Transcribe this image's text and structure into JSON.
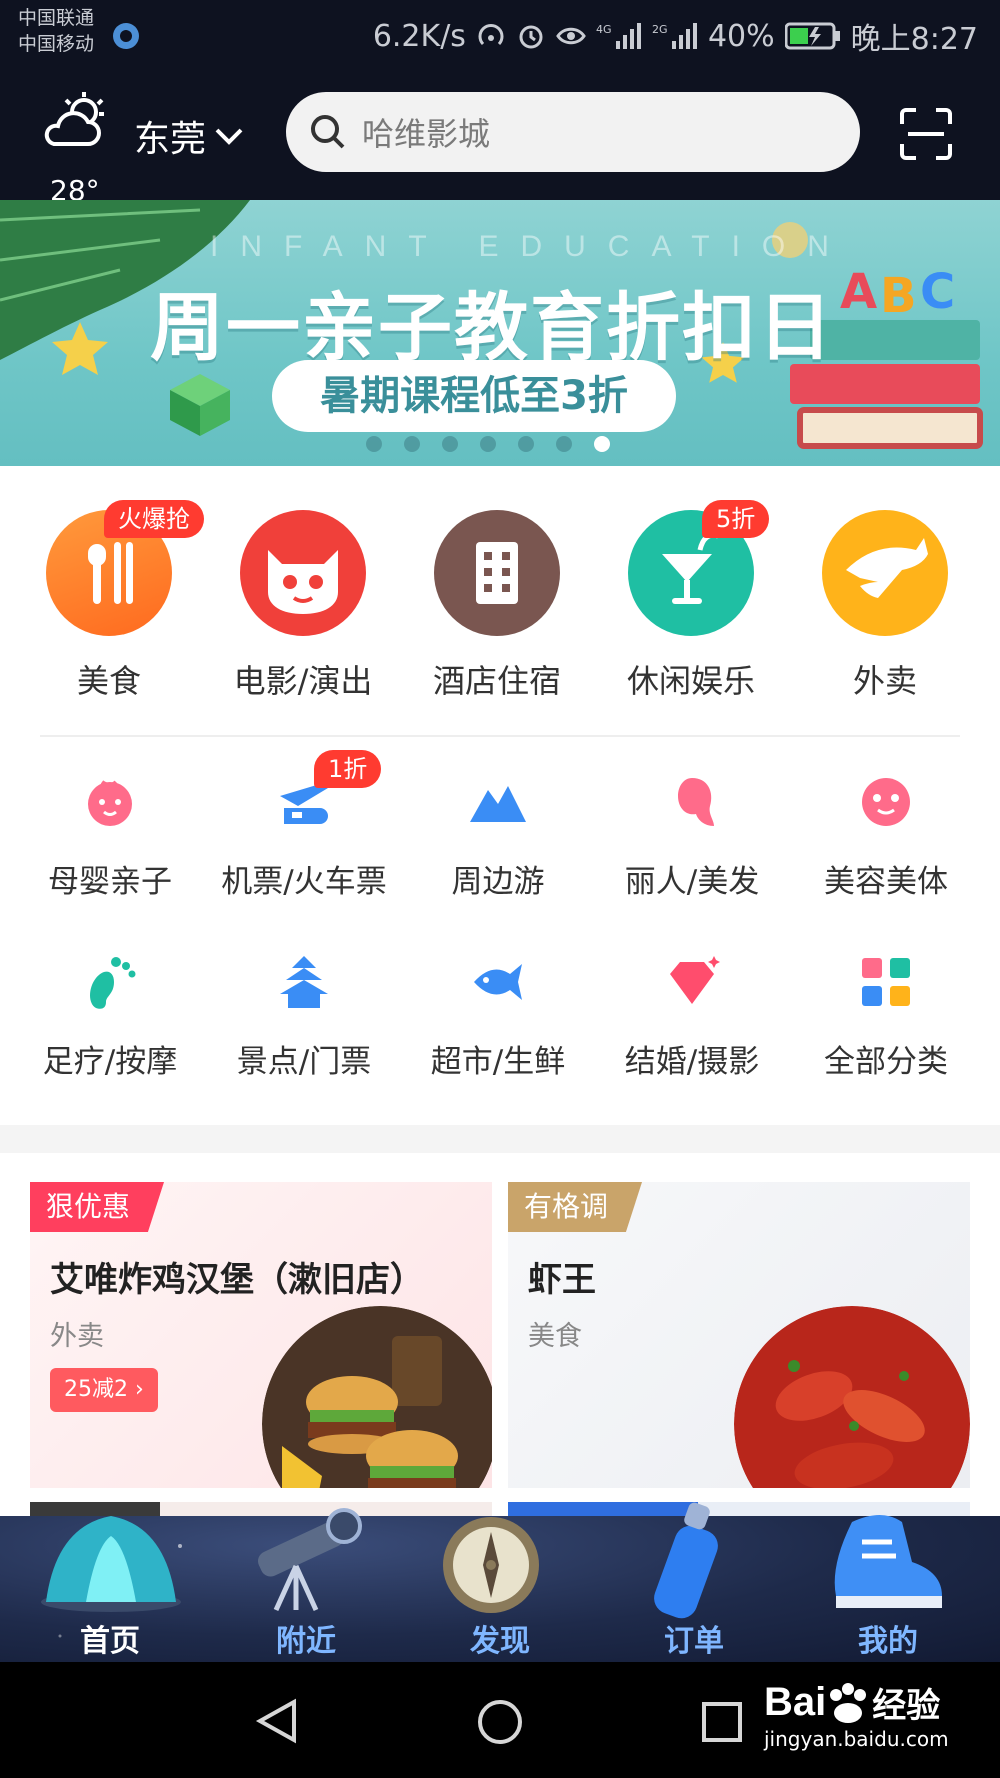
{
  "status_bar": {
    "carrier1": "中国联通",
    "carrier2": "中国移动",
    "speed": "6.2K/s",
    "battery": "40%",
    "time": "晚上8:27"
  },
  "header": {
    "temperature": "28°",
    "city": "东莞",
    "search_placeholder": "哈维影城"
  },
  "banner": {
    "subtitle_en": "INFANT EDUCATION",
    "title": "周一亲子教育折扣日",
    "pill": "暑期课程低至3折",
    "slide_count": 7,
    "active_slide": 7
  },
  "primary_categories": [
    {
      "label": "美食",
      "badge": "火爆抢",
      "icon": "fork-knife-icon",
      "color": "#ff7a2e"
    },
    {
      "label": "电影/演出",
      "badge": "",
      "icon": "cat-face-icon",
      "color": "#f0403a"
    },
    {
      "label": "酒店住宿",
      "badge": "",
      "icon": "building-icon",
      "color": "#7a5650"
    },
    {
      "label": "休闲娱乐",
      "badge": "5折",
      "icon": "cocktail-icon",
      "color": "#1fbfa3"
    },
    {
      "label": "外卖",
      "badge": "",
      "icon": "kangaroo-icon",
      "color": "#ffb31a"
    }
  ],
  "secondary_categories": [
    {
      "label": "母婴亲子",
      "badge": "",
      "icon": "baby-icon",
      "color": "#ff6b8a"
    },
    {
      "label": "机票/火车票",
      "badge": "1折",
      "icon": "plane-train-icon",
      "color": "#3a8df5"
    },
    {
      "label": "周边游",
      "badge": "",
      "icon": "mountain-icon",
      "color": "#3a8df5"
    },
    {
      "label": "丽人/美发",
      "badge": "",
      "icon": "woman-hair-icon",
      "color": "#ff6b8a"
    },
    {
      "label": "美容美体",
      "badge": "",
      "icon": "face-mask-icon",
      "color": "#ff6b8a"
    },
    {
      "label": "足疗/按摩",
      "badge": "",
      "icon": "footprint-icon",
      "color": "#1fbfa3"
    },
    {
      "label": "景点/门票",
      "badge": "",
      "icon": "pagoda-icon",
      "color": "#3a8df5"
    },
    {
      "label": "超市/生鲜",
      "badge": "",
      "icon": "fish-icon",
      "color": "#3a8df5"
    },
    {
      "label": "结婚/摄影",
      "badge": "",
      "icon": "diamond-icon",
      "color": "#ff4d6d"
    },
    {
      "label": "全部分类",
      "badge": "",
      "icon": "grid-icon",
      "color": "#3a8df5"
    }
  ],
  "cards": [
    {
      "tag": "狠优惠",
      "name": "艾唯炸鸡汉堡（漱旧店）",
      "category": "外卖",
      "deal": "25减2 ›",
      "photo": "burger-photo"
    },
    {
      "tag": "有格调",
      "name": "虾王",
      "category": "美食",
      "deal": "",
      "photo": "crayfish-photo"
    }
  ],
  "tabs": [
    {
      "label": "首页",
      "icon": "tent-icon",
      "active": true
    },
    {
      "label": "附近",
      "icon": "telescope-icon",
      "active": false
    },
    {
      "label": "发现",
      "icon": "compass-icon",
      "active": false
    },
    {
      "label": "订单",
      "icon": "bottle-icon",
      "active": false
    },
    {
      "label": "我的",
      "icon": "shoe-icon",
      "active": false
    }
  ],
  "watermark": {
    "brand": "Bai",
    "brand_suffix": "经验",
    "url": "jingyan.baidu.com"
  },
  "colors": {
    "header_bg": "#0e1220",
    "accent_red": "#ff3b30",
    "tab_active": "#ffffff",
    "tab_inactive": "#7fb6ff"
  }
}
